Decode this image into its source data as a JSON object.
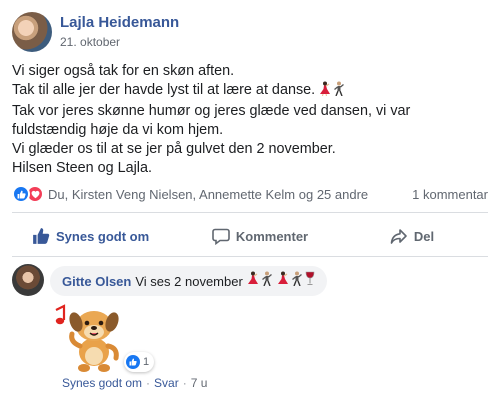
{
  "post": {
    "author": "Lajla Heidemann",
    "date": "21. oktober",
    "lines": [
      "Vi siger også tak for en skøn aften.",
      "Tak til alle jer der havde lyst til at lære at danse.",
      "Tak vor jeres skønne humør og jeres glæde ved dansen, vi var fuldstændig høje da vi kom hjem.",
      "Vi glæder os til at se jer på gulvet den 2 november.",
      "Hilsen Steen og Lajla."
    ],
    "line2_emoji": [
      "dancer-woman-emoji",
      "dancer-man-emoji"
    ]
  },
  "reactions": {
    "icons": [
      "like-reaction-icon",
      "love-reaction-icon"
    ],
    "names": "Du, Kirsten Veng Nielsen, Annemette Kelm og 25 andre",
    "comment_count": "1 kommentar"
  },
  "actions": {
    "like": "Synes godt om",
    "comment": "Kommenter",
    "share": "Del"
  },
  "comment": {
    "author": "Gitte Olsen",
    "text": "Vi ses 2 november",
    "emoji": [
      "dancer-woman-emoji",
      "dancer-man-emoji",
      "dancer-woman-emoji",
      "dancer-man-emoji",
      "wine-glass-emoji"
    ],
    "sticker": "dancing-dog-sticker",
    "reaction_count": "1",
    "like_label": "Synes godt om",
    "reply_label": "Svar",
    "separator": "·",
    "time": "7 u"
  },
  "colors": {
    "link_blue": "#385898",
    "like_blue": "#1877f2",
    "love_red": "#f33e58",
    "meta_gray": "#616770",
    "bubble_bg": "#f2f3f5",
    "divider": "#dadde1"
  }
}
